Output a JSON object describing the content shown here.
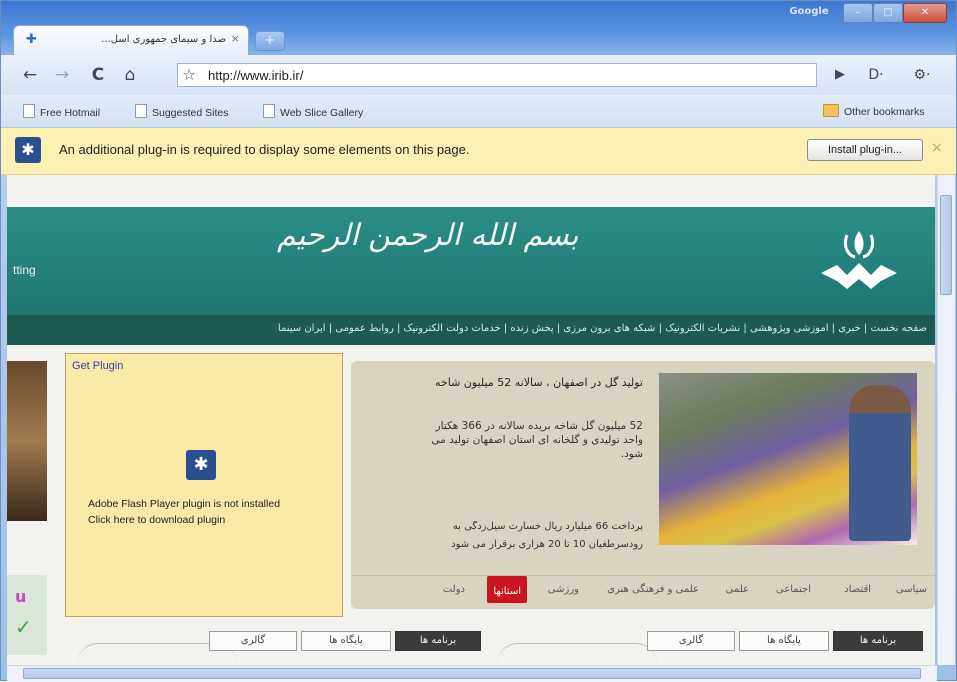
{
  "window": {
    "tab_title": "صدا و سیمای جمهوری اسل...",
    "tab_close": "×",
    "new_tab": "+",
    "brand": "Google",
    "min": "–",
    "max": "□",
    "close": "✕"
  },
  "toolbar": {
    "back": "←",
    "forward": "→",
    "reload": "C",
    "home": "⌂",
    "star": "☆",
    "url": "http://www.irib.ir/",
    "go": "▶",
    "page_menu": "D·",
    "tools_menu": "⚙·"
  },
  "bookmarks": {
    "items": [
      "Free Hotmail",
      "Suggested Sites",
      "Web Slice Gallery"
    ],
    "other": "Other bookmarks"
  },
  "infobar": {
    "icon": "puzzle-piece-icon",
    "message": "An additional plug-in is required to display some elements on this page.",
    "install_label": "Install plug-in...",
    "close": "×"
  },
  "site": {
    "banner_left": "tting",
    "calligraphy": "بسم الله الرحمن الرحیم",
    "nav": "صفحه نخست | خبری | آموزشی وپژوهشی | نشریات الکترونیک | شبکه های برون مرزی | پخش زنده | خدمات دولت الکترونیک | روابط عمومی | ایران سینما",
    "plugin_title": "Get Plugin",
    "plugin_line1": "Adobe Flash Player plugin is not installed",
    "plugin_line2": "Click here to download plugin",
    "news_title": "تولید گل در اصفهان ، سالانه 52 میلیون شاخه",
    "news_body": "52 میلیون گل شاخه بریده سالانه در 366 هکتار واحد تولیدی و گلخانه ای استان اصفهان تولید می شود.",
    "news_bullet1": "پرداخت 66 میلیارد ریال خسارت سیل‌زدگی به",
    "news_bullet2": "رودسرطغیان 10 تا 20 هزاری برقرار می شود",
    "news_tabs": [
      "سیاسی",
      "اقتصاد",
      "اجتماعی",
      "علمی",
      "علمی و فرهنگی هنری",
      "ورزشی",
      "استانها",
      "دولت"
    ],
    "news_active_tab": "استانها",
    "bottom_tabs_right": [
      "برنامه ها",
      "پایگاه ها",
      "گالری"
    ],
    "bottom_tabs_left": [
      "برنامه ها",
      "پایگاه ها",
      "گالری"
    ]
  },
  "colors": {
    "header_teal": "#2c8e88",
    "nav_dark": "#1d5a52",
    "infobar_yellow": "#fcf0b3",
    "plugin_box": "#fbe9a8",
    "active_tab_red": "#c9161e"
  }
}
